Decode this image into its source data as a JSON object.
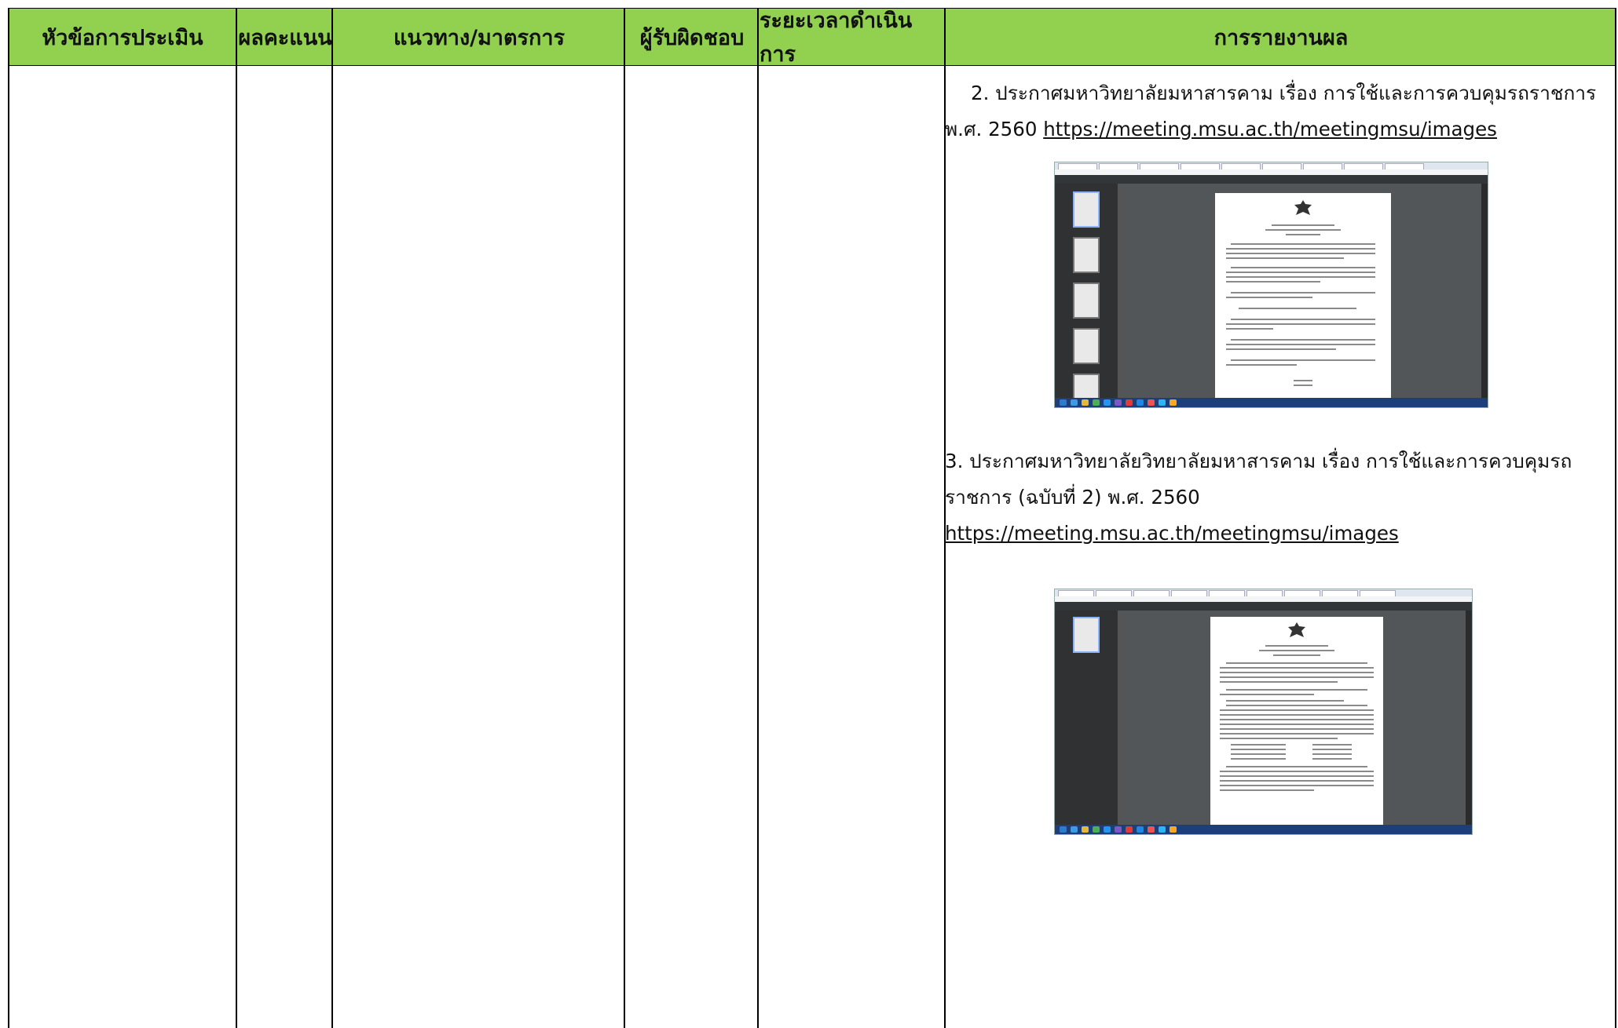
{
  "table": {
    "headers": [
      "หัวข้อการประเมิน",
      "ผลคะแนน",
      "แนวทาง/มาตรการ",
      "ผู้รับผิดชอบ",
      "ระยะเวลาดำเนินการ",
      "การรายงานผล"
    ],
    "header_bg": "#92d050"
  },
  "report": {
    "item2": {
      "line1": "2. ประกาศมหาวิทยาลัยมหาสารคาม เรื่อง การใช้และการควบคุมรถราชการ",
      "line2_prefix": "พ.ศ. 2560 ",
      "link": "https://meeting.msu.ac.th/meetingmsu/images"
    },
    "item3": {
      "line1": "3. ประกาศมหาวิทยาลัยวิทยาลัยมหาสารคาม เรื่อง การใช้และการควบคุมรถ",
      "line2": "ราชการ (ฉบับที่ 2) พ.ศ. 2560",
      "link": "https://meeting.msu.ac.th/meetingmsu/images"
    }
  },
  "images": {
    "screenshot1": "pdf-viewer-screenshot",
    "screenshot2": "pdf-viewer-screenshot"
  }
}
